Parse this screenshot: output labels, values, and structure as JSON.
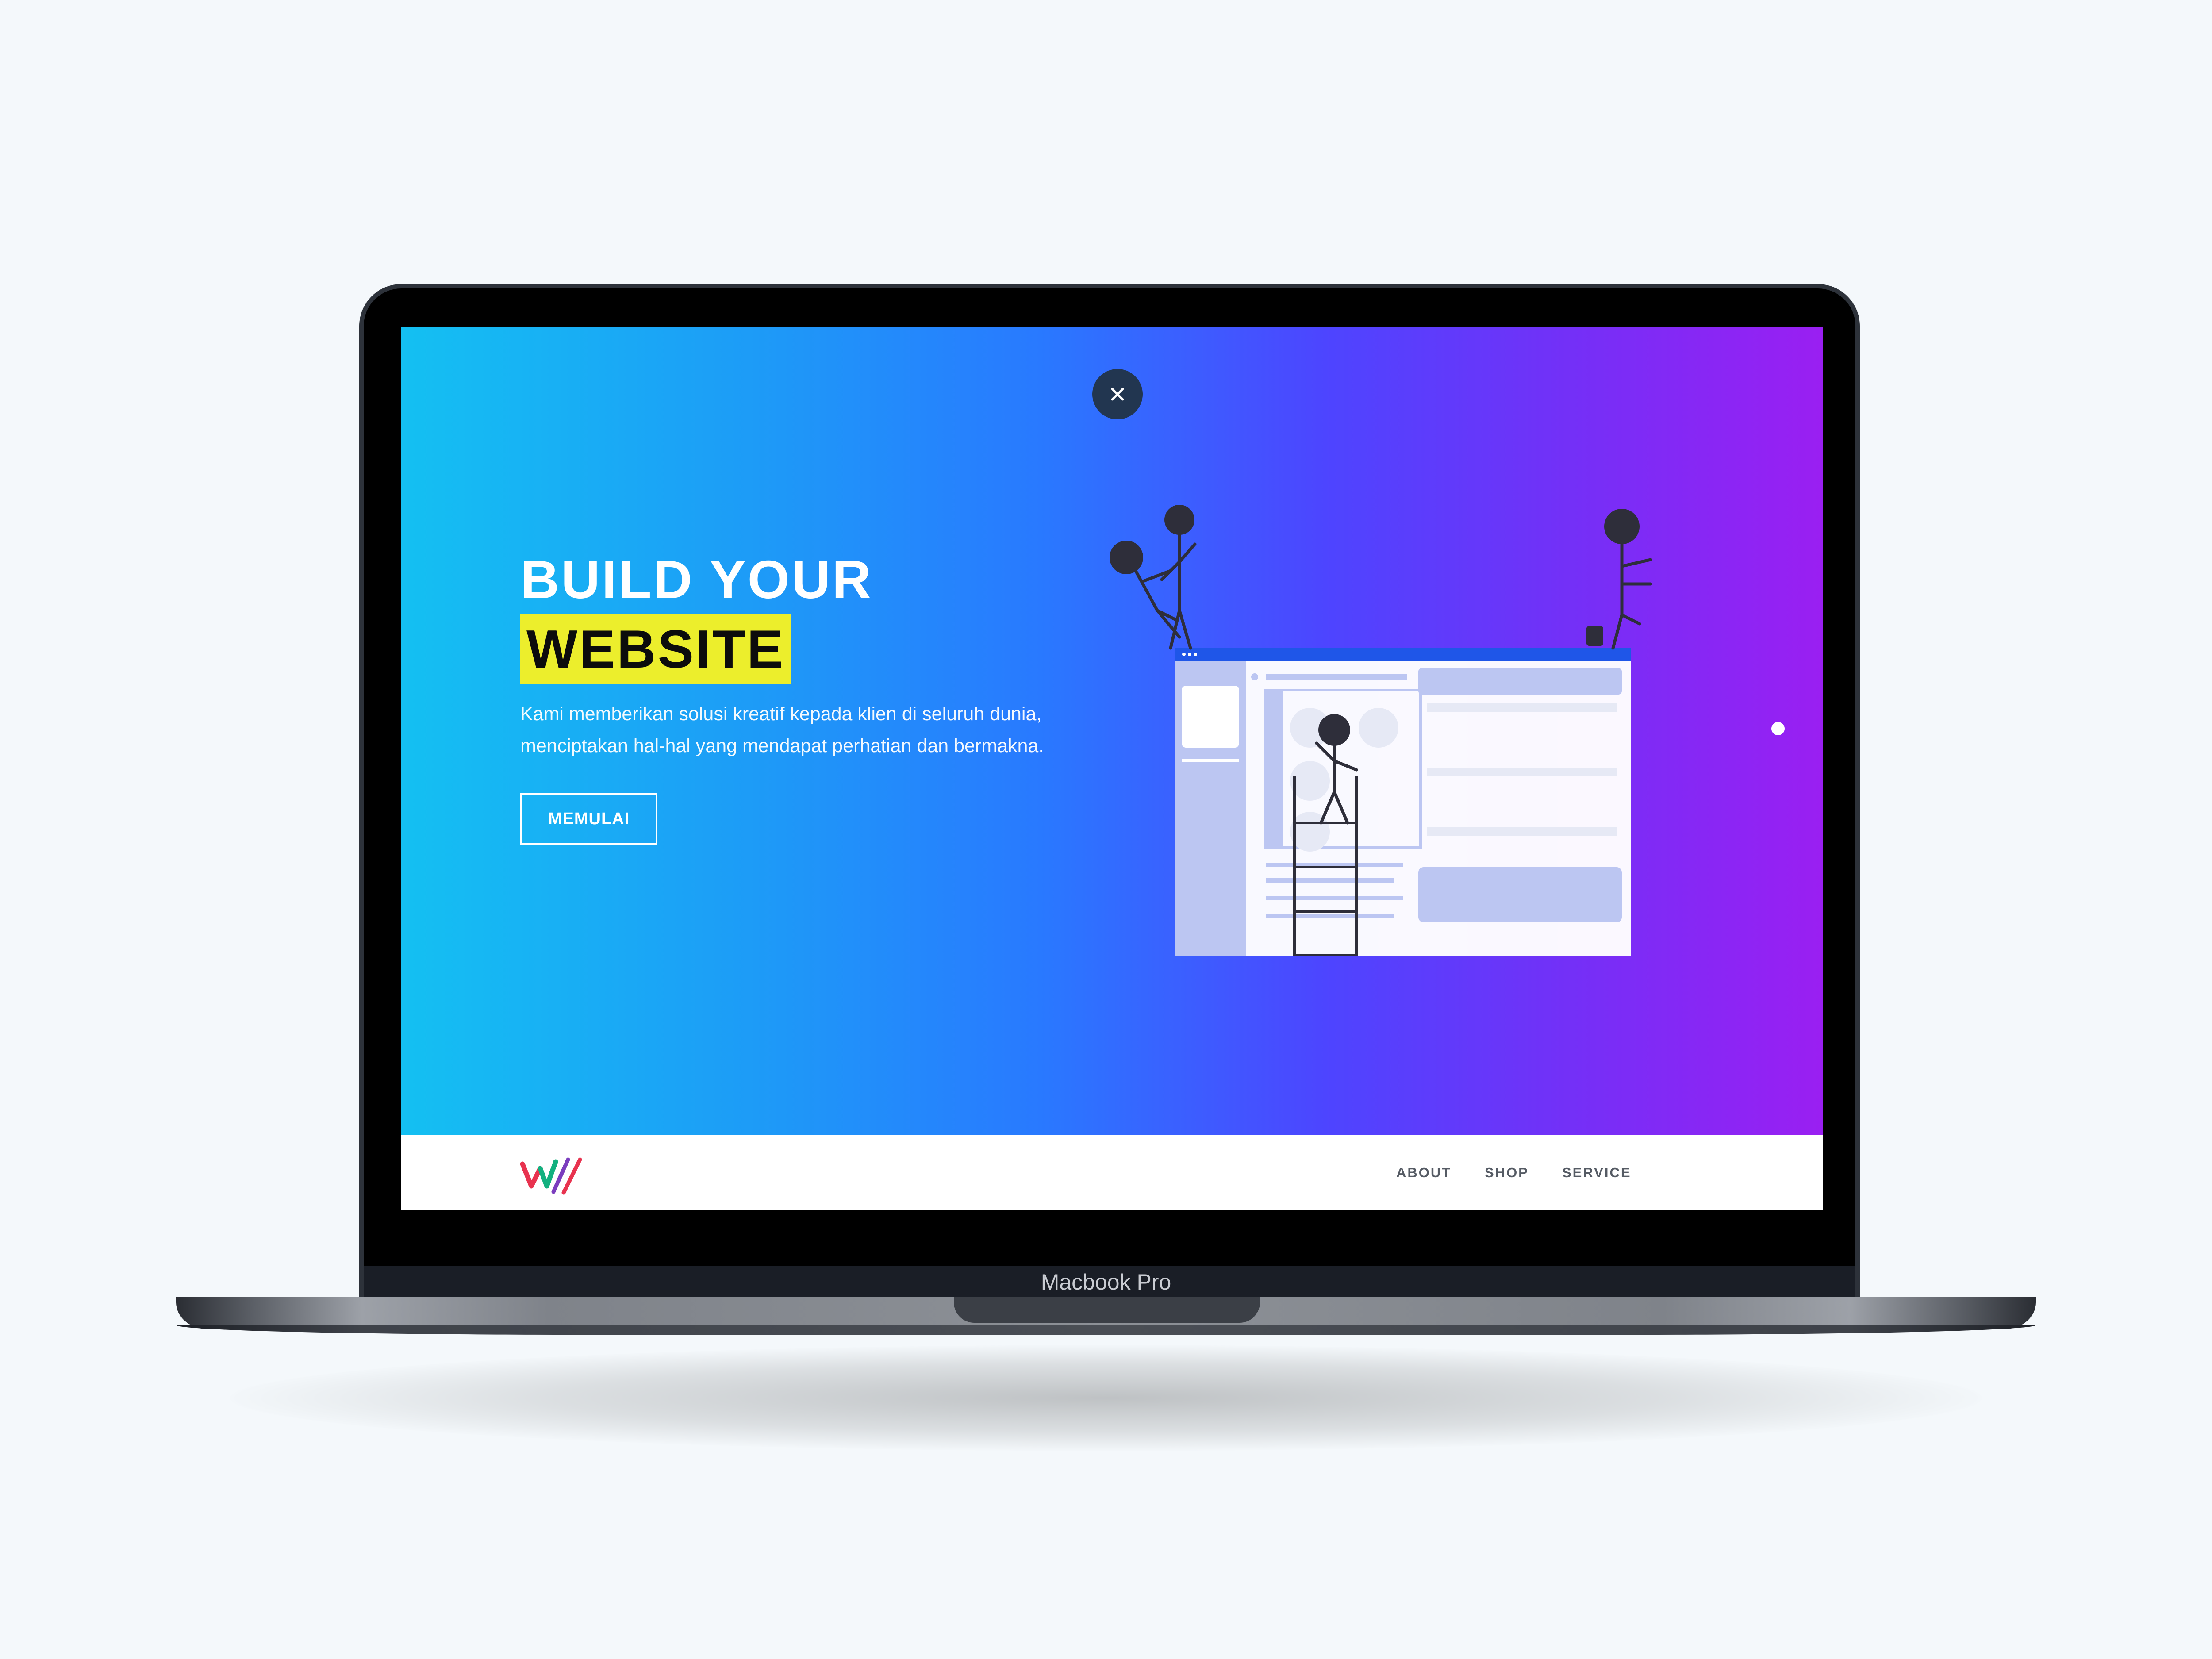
{
  "device": {
    "label": "Macbook Pro"
  },
  "hero": {
    "close_icon": "close-icon",
    "headline_line1": "BUILD YOUR",
    "headline_line2": "WEBSITE",
    "subtitle": "Kami memberikan solusi kreatif kepada klien di seluruh dunia, menciptakan hal-hal yang mendapat perhatian dan bermakna.",
    "cta_label": "MEMULAI",
    "gradient": [
      "#14c0f2",
      "#2979ff",
      "#9a1ff2"
    ],
    "highlight_color": "#ecee2c"
  },
  "nav": {
    "logo": "w-logo",
    "items": [
      {
        "label": "ABOUT"
      },
      {
        "label": "SHOP"
      },
      {
        "label": "SERVICE"
      }
    ]
  }
}
